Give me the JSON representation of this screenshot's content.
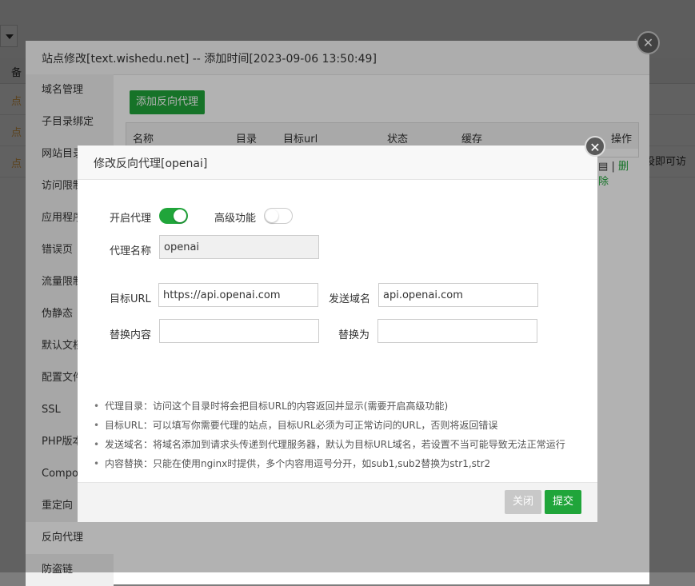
{
  "background": {
    "col_header": "备",
    "rows": [
      "点",
      "点",
      "点"
    ],
    "right_text": "设即可访"
  },
  "outer_dialog": {
    "title": "站点修改[text.wishedu.net] -- 添加时间[2023-09-06 13:50:49]",
    "sidebar": [
      "域名管理",
      "子目录绑定",
      "网站目录",
      "访问限制",
      "应用程序",
      "错误页",
      "流量限制",
      "伪静态",
      "默认文档",
      "配置文件",
      "SSL",
      "PHP版本",
      "Composer",
      "重定向",
      "反向代理",
      "防盗链"
    ],
    "active_item": "反向代理",
    "add_button": "添加反向代理",
    "table_headers": [
      "名称",
      "目录",
      "目标url",
      "状态",
      "缓存",
      "操作"
    ],
    "row_ops": {
      "edit": "▤",
      "separator": "|",
      "delete": "删除"
    }
  },
  "modal": {
    "title": "修改反向代理[openai]",
    "enable_proxy_label": "开启代理",
    "enable_proxy": true,
    "advanced_label": "高级功能",
    "advanced": false,
    "proxy_name_label": "代理名称",
    "proxy_name": "openai",
    "target_url_label": "目标URL",
    "target_url": "https://api.openai.com",
    "send_domain_label": "发送域名",
    "send_domain": "api.openai.com",
    "replace_content_label": "替换内容",
    "replace_content": "",
    "replace_with_label": "替换为",
    "replace_with": "",
    "tips": [
      "代理目录：访问这个目录时将会把目标URL的内容返回并显示(需要开启高级功能)",
      "目标URL：可以填写你需要代理的站点，目标URL必须为可正常访问的URL，否则将返回错误",
      "发送域名：将域名添加到请求头传递到代理服务器，默认为目标URL域名，若设置不当可能导致无法正常运行",
      "内容替换：只能在使用nginx时提供，多个内容用逗号分开，如sub1,sub2替换为str1,str2"
    ],
    "close_button": "关闭",
    "submit_button": "提交"
  },
  "colors": {
    "accent": "#20a53a",
    "orange_text": "#f0ad4e"
  }
}
